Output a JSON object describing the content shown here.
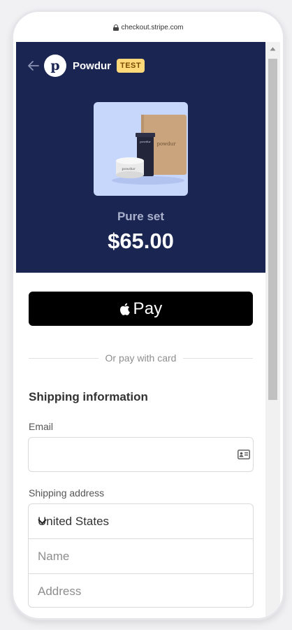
{
  "browser": {
    "url": "checkout.stripe.com"
  },
  "merchant": {
    "logo_letter": "p",
    "name": "Powdur",
    "badge": "TEST"
  },
  "product": {
    "name": "Pure set",
    "price": "$65.00",
    "image_texts": {
      "box_label": "powdur",
      "tube_label": "powdur",
      "jar_label": "powdur"
    }
  },
  "payment": {
    "apple_pay_label": "Pay",
    "divider_text": "Or pay with card"
  },
  "shipping": {
    "title": "Shipping information",
    "email_label": "Email",
    "email_value": "",
    "address_label": "Shipping address",
    "country_value": "United States",
    "name_placeholder": "Name",
    "address_placeholder": "Address"
  },
  "colors": {
    "header_bg": "#1a2552",
    "badge_bg": "#ffd87a",
    "apple_pay_bg": "#000000"
  }
}
